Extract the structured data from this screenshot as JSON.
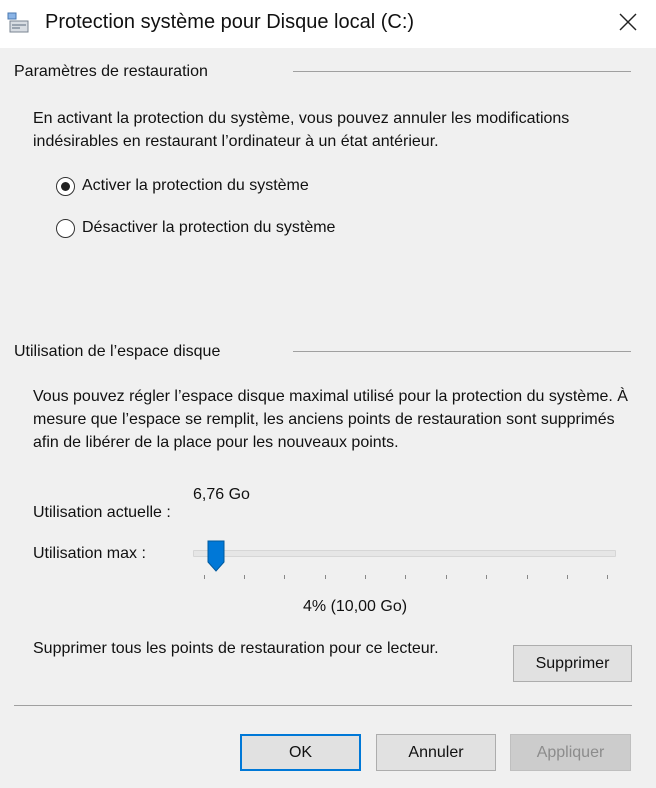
{
  "window": {
    "title": "Protection système pour Disque local (C:)",
    "icon": "system-properties-icon",
    "close_icon": "close-icon"
  },
  "restore_settings": {
    "heading": "Paramètres de restauration",
    "description": "En activant la protection du système, vous pouvez annuler les modifications indésirables en restaurant l’ordinateur à un état antérieur.",
    "options": [
      {
        "label": "Activer la protection du système",
        "selected": true
      },
      {
        "label": "Désactiver la protection du système",
        "selected": false
      }
    ]
  },
  "disk_usage": {
    "heading": "Utilisation de l’espace disque",
    "description": "Vous pouvez régler l’espace disque maximal utilisé pour la protection du système. À mesure que l’espace se remplit, les anciens points de restauration sont supprimés afin de libérer de la place pour les nouveaux points.",
    "current_label": "Utilisation actuelle :",
    "current_value": "6,76 Go",
    "max_label": "Utilisation max :",
    "max_value_text": "4% (10,00 Go)",
    "slider_percent": 4,
    "delete_text": "Supprimer tous les points de restauration pour ce lecteur.",
    "delete_button": "Supprimer"
  },
  "footer": {
    "ok": "OK",
    "cancel": "Annuler",
    "apply": "Appliquer"
  },
  "colors": {
    "accent": "#0078d7",
    "background": "#f0f0f0"
  }
}
